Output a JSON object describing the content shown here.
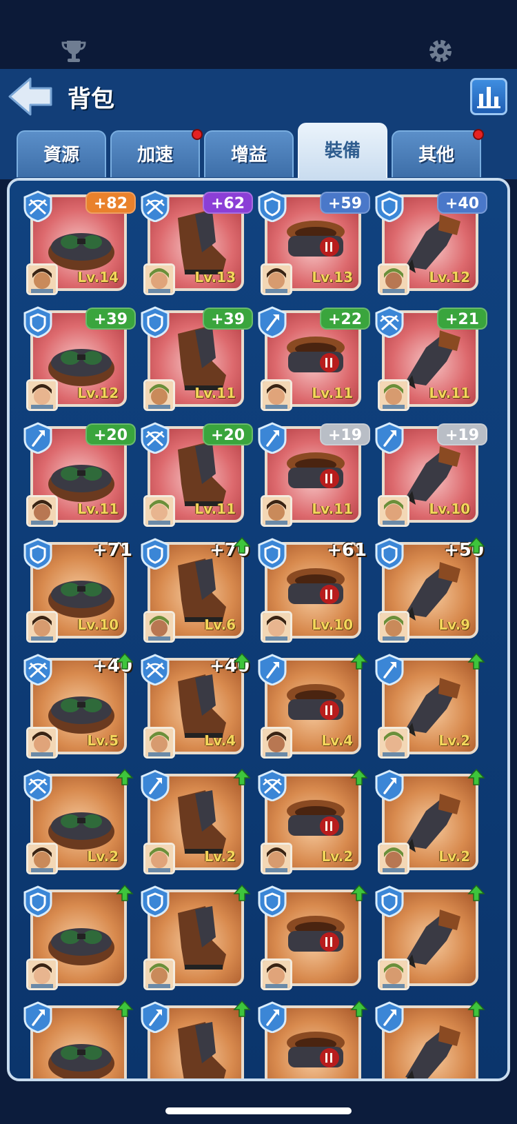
{
  "header": {
    "title": "背包"
  },
  "tabs": [
    {
      "label": "資源",
      "active": false,
      "badge": false
    },
    {
      "label": "加速",
      "active": false,
      "badge": true
    },
    {
      "label": "增益",
      "active": false,
      "badge": false
    },
    {
      "label": "裝備",
      "active": true,
      "badge": false
    },
    {
      "label": "其他",
      "active": false,
      "badge": true
    }
  ],
  "colors": {
    "bonus_orange": "#e9812c",
    "bonus_purple": "#8b3fd6",
    "bonus_blue": "#4a78c9",
    "bonus_green": "#3aa53d",
    "bonus_gray": "#b9bec6",
    "up_arrow": "#3ec53c",
    "badge_red": "#e52222"
  },
  "items": [
    {
      "bonus": "+82",
      "bonus_style": "orange",
      "level": "Lv.14",
      "class_icon": "crossbow-icon",
      "rarity": "red"
    },
    {
      "bonus": "+62",
      "bonus_style": "purple",
      "level": "Lv.13",
      "class_icon": "crossbow-icon",
      "rarity": "red"
    },
    {
      "bonus": "+59",
      "bonus_style": "blue",
      "level": "Lv.13",
      "class_icon": "shield-icon",
      "rarity": "red"
    },
    {
      "bonus": "+40",
      "bonus_style": "blue",
      "level": "Lv.12",
      "class_icon": "shield-icon",
      "rarity": "red"
    },
    {
      "bonus": "+39",
      "bonus_style": "green",
      "level": "Lv.12",
      "class_icon": "shield-icon",
      "rarity": "red"
    },
    {
      "bonus": "+39",
      "bonus_style": "green",
      "level": "Lv.11",
      "class_icon": "shield-icon",
      "rarity": "red"
    },
    {
      "bonus": "+22",
      "bonus_style": "green",
      "level": "Lv.11",
      "class_icon": "wand-icon",
      "rarity": "red"
    },
    {
      "bonus": "+21",
      "bonus_style": "green",
      "level": "Lv.11",
      "class_icon": "crossbow-icon",
      "rarity": "red"
    },
    {
      "bonus": "+20",
      "bonus_style": "green",
      "level": "Lv.11",
      "class_icon": "wand-icon",
      "rarity": "red"
    },
    {
      "bonus": "+20",
      "bonus_style": "green",
      "level": "Lv.11",
      "class_icon": "crossbow-icon",
      "rarity": "red"
    },
    {
      "bonus": "+19",
      "bonus_style": "gray",
      "level": "Lv.11",
      "class_icon": "wand-icon",
      "rarity": "red"
    },
    {
      "bonus": "+19",
      "bonus_style": "gray",
      "level": "Lv.10",
      "class_icon": "wand-icon",
      "rarity": "red"
    },
    {
      "bonus": "+71",
      "bonus_style": "plain",
      "level": "Lv.10",
      "class_icon": "shield-icon",
      "rarity": "orange",
      "upgrade": false
    },
    {
      "bonus": "+70",
      "bonus_style": "plain",
      "level": "Lv.6",
      "class_icon": "shield-icon",
      "rarity": "orange",
      "upgrade": true
    },
    {
      "bonus": "+61",
      "bonus_style": "plain",
      "level": "Lv.10",
      "class_icon": "shield-icon",
      "rarity": "orange",
      "upgrade": false
    },
    {
      "bonus": "+50",
      "bonus_style": "plain",
      "level": "Lv.9",
      "class_icon": "shield-icon",
      "rarity": "orange",
      "upgrade": true
    },
    {
      "bonus": "+40",
      "bonus_style": "plain",
      "level": "Lv.5",
      "class_icon": "crossbow-icon",
      "rarity": "orange",
      "upgrade": true
    },
    {
      "bonus": "+40",
      "bonus_style": "plain",
      "level": "Lv.4",
      "class_icon": "crossbow-icon",
      "rarity": "orange",
      "upgrade": true
    },
    {
      "bonus": "",
      "bonus_style": "none",
      "level": "Lv.4",
      "class_icon": "wand-icon",
      "rarity": "orange",
      "upgrade": true
    },
    {
      "bonus": "",
      "bonus_style": "none",
      "level": "Lv.2",
      "class_icon": "wand-icon",
      "rarity": "orange",
      "upgrade": true
    },
    {
      "bonus": "",
      "bonus_style": "none",
      "level": "Lv.2",
      "class_icon": "crossbow-icon",
      "rarity": "orange",
      "upgrade": true
    },
    {
      "bonus": "",
      "bonus_style": "none",
      "level": "Lv.2",
      "class_icon": "wand-icon",
      "rarity": "orange",
      "upgrade": true
    },
    {
      "bonus": "",
      "bonus_style": "none",
      "level": "Lv.2",
      "class_icon": "crossbow-icon",
      "rarity": "orange",
      "upgrade": true
    },
    {
      "bonus": "",
      "bonus_style": "none",
      "level": "Lv.2",
      "class_icon": "wand-icon",
      "rarity": "orange",
      "upgrade": true
    },
    {
      "bonus": "",
      "bonus_style": "none",
      "level": "",
      "class_icon": "shield-icon",
      "rarity": "orange",
      "upgrade": true
    },
    {
      "bonus": "",
      "bonus_style": "none",
      "level": "",
      "class_icon": "shield-icon",
      "rarity": "orange",
      "upgrade": true
    },
    {
      "bonus": "",
      "bonus_style": "none",
      "level": "",
      "class_icon": "shield-icon",
      "rarity": "orange",
      "upgrade": true
    },
    {
      "bonus": "",
      "bonus_style": "none",
      "level": "",
      "class_icon": "shield-icon",
      "rarity": "orange",
      "upgrade": true
    },
    {
      "bonus": "",
      "bonus_style": "none",
      "level": "",
      "class_icon": "wand-icon",
      "rarity": "orange",
      "upgrade": true
    },
    {
      "bonus": "",
      "bonus_style": "none",
      "level": "",
      "class_icon": "wand-icon",
      "rarity": "orange",
      "upgrade": true
    },
    {
      "bonus": "",
      "bonus_style": "none",
      "level": "",
      "class_icon": "wand-icon",
      "rarity": "orange",
      "upgrade": true
    },
    {
      "bonus": "",
      "bonus_style": "none",
      "level": "",
      "class_icon": "wand-icon",
      "rarity": "orange",
      "upgrade": true
    }
  ]
}
